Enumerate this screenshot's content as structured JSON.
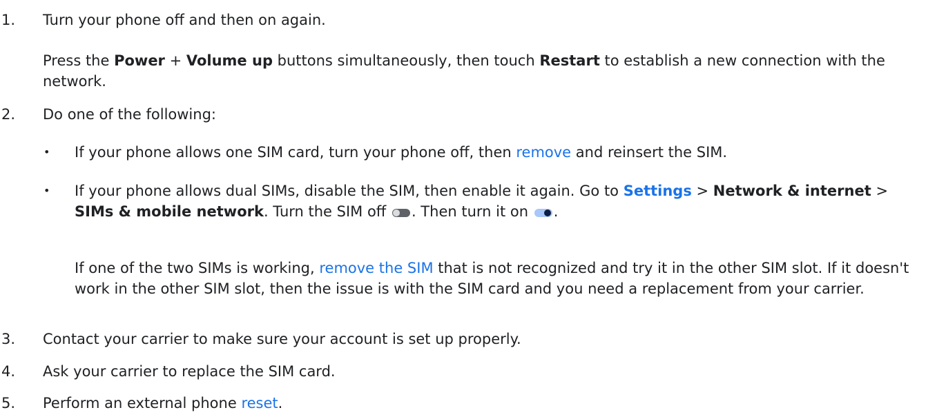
{
  "steps": [
    {
      "number": "1.",
      "text": "Turn your phone off and then on again.",
      "detail": {
        "t1": "Press the ",
        "b1": "Power",
        "t2": " + ",
        "b2": "Volume up",
        "t3": " buttons simultaneously, then touch ",
        "b3": "Restart",
        "t4": " to establish a new connection with the network."
      }
    },
    {
      "number": "2.",
      "text": "Do one of the following:",
      "bullets": [
        {
          "bullet": "•",
          "t1": "If your phone allows one SIM card, turn your phone off, then ",
          "link": "remove",
          "t2": " and reinsert the SIM."
        },
        {
          "bullet": "•",
          "t1": "If your phone allows dual SIMs, disable the SIM, then enable it again. Go to ",
          "link_bold": "Settings",
          "t2": " > ",
          "b1": "Network & internet",
          "t3": " > ",
          "b2": "SIMs & mobile network",
          "t4": ". Turn the SIM off ",
          "t5": ". Then turn it on ",
          "t6": "."
        }
      ],
      "note": {
        "t1": "If one of the two SIMs is working, ",
        "link": "remove the SIM",
        "t2": " that is not recognized and try it in the other SIM slot. If it doesn't work in the other SIM slot, then the issue is with the SIM card and you need a replacement from your carrier."
      }
    },
    {
      "number": "3.",
      "text": "Contact your carrier to make sure your account is set up properly."
    },
    {
      "number": "4.",
      "text": "Ask your carrier to replace the SIM card."
    },
    {
      "number": "5.",
      "t1": "Perform an external phone ",
      "link": "reset",
      "t2": "."
    }
  ],
  "colors": {
    "text": "#202124",
    "link": "#1a73e8",
    "toggle_off_track": "#5f6368",
    "toggle_on_track": "#a8c7fa",
    "toggle_on_knob": "#0b1f45"
  },
  "icons": {
    "toggle_off": "toggle-off-icon",
    "toggle_on": "toggle-on-icon"
  }
}
